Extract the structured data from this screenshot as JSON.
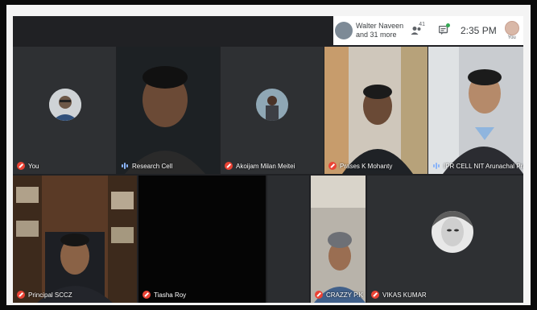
{
  "topbar": {
    "participants_label": "Walter Naveen and 31 more",
    "people_count": "41",
    "time": "2:35 PM",
    "self_label": "You",
    "icons": [
      "people-icon",
      "chat-icon"
    ]
  },
  "tiles": [
    {
      "name": "You",
      "muted": true
    },
    {
      "name": "Research Cell",
      "muted": false
    },
    {
      "name": "Akoijam Milan Meitei",
      "muted": true
    },
    {
      "name": "Prases K Mohanty",
      "muted": true
    },
    {
      "name": "IPR CELL NIT Arunachal Pradesh",
      "muted": false
    },
    {
      "name": "Principal SCCZ",
      "muted": true
    },
    {
      "name": "Tiasha Roy",
      "muted": true
    },
    {
      "name": "CRAZZY P.K",
      "muted": true
    },
    {
      "name": "VIKAS KUMAR",
      "muted": true
    }
  ],
  "colors": {
    "background": "#202124",
    "tile": "#3c4043",
    "muted_mic": "#ea4335",
    "speaking": "#8ab4f8"
  }
}
